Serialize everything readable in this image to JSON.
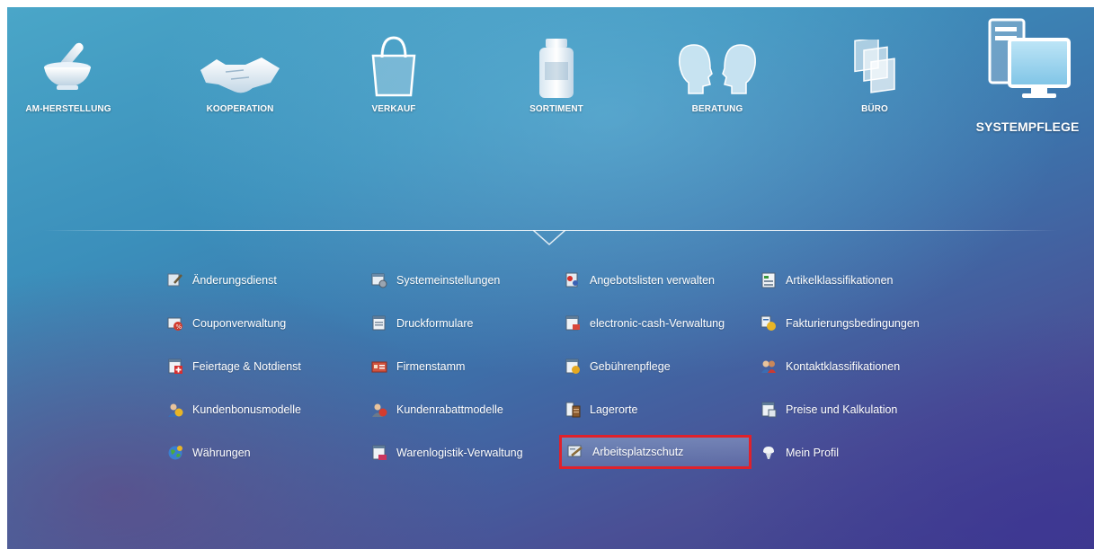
{
  "topnav": {
    "items": [
      {
        "label": "AM-HERSTELLUNG",
        "icon": "mortar-pestle-icon"
      },
      {
        "label": "KOOPERATION",
        "icon": "handshake-icon"
      },
      {
        "label": "VERKAUF",
        "icon": "shopping-bag-icon"
      },
      {
        "label": "SORTIMENT",
        "icon": "medicine-jar-icon"
      },
      {
        "label": "BERATUNG",
        "icon": "two-heads-icon"
      },
      {
        "label": "BÜRO",
        "icon": "documents-icon"
      },
      {
        "label": "SYSTEMPFLEGE",
        "icon": "computer-monitor-icon",
        "active": true
      }
    ]
  },
  "menu": {
    "rows": [
      [
        {
          "label": "Änderungsdienst",
          "icon": "change-service-icon"
        },
        {
          "label": "Systemeinstellungen",
          "icon": "system-settings-icon"
        },
        {
          "label": "Angebotslisten verwalten",
          "icon": "offer-lists-icon"
        },
        {
          "label": "Artikelklassifikationen",
          "icon": "article-classification-icon"
        }
      ],
      [
        {
          "label": "Couponverwaltung",
          "icon": "coupon-icon"
        },
        {
          "label": "Druckformulare",
          "icon": "print-forms-icon"
        },
        {
          "label": "electronic-cash-Verwaltung",
          "icon": "electronic-cash-icon"
        },
        {
          "label": "Fakturierungsbedingungen",
          "icon": "billing-terms-icon"
        }
      ],
      [
        {
          "label": "Feiertage & Notdienst",
          "icon": "holiday-emergency-icon"
        },
        {
          "label": "Firmenstamm",
          "icon": "company-master-icon"
        },
        {
          "label": "Gebührenpflege",
          "icon": "fees-icon"
        },
        {
          "label": "Kontaktklassifikationen",
          "icon": "contact-classification-icon"
        }
      ],
      [
        {
          "label": "Kundenbonusmodelle",
          "icon": "customer-bonus-icon"
        },
        {
          "label": "Kundenrabattmodelle",
          "icon": "customer-discount-icon"
        },
        {
          "label": "Lagerorte",
          "icon": "storage-locations-icon"
        },
        {
          "label": "Preise und Kalkulation",
          "icon": "prices-calculation-icon"
        }
      ],
      [
        {
          "label": "Währungen",
          "icon": "currencies-globe-icon"
        },
        {
          "label": "Warenlogistik-Verwaltung",
          "icon": "goods-logistics-icon"
        },
        {
          "label": "Arbeitsplatzschutz",
          "icon": "workstation-protection-icon",
          "selected": true
        },
        {
          "label": "Mein Profil",
          "icon": "my-profile-icon"
        }
      ]
    ]
  },
  "colors": {
    "highlight_border": "#e0212b",
    "text": "#ffffff"
  }
}
